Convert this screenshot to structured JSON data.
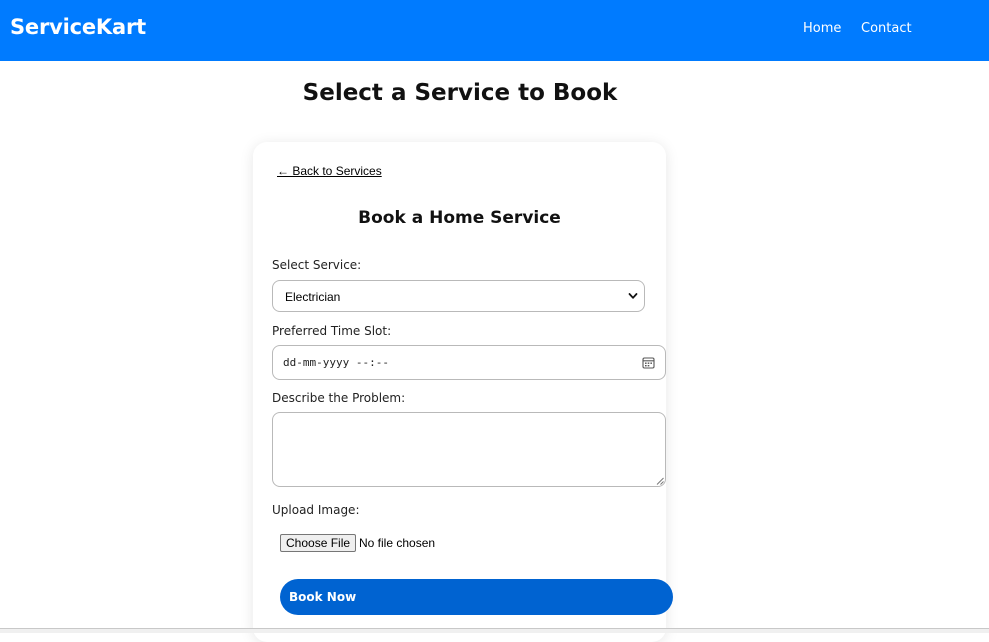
{
  "navbar": {
    "brand": "ServiceKart",
    "links": [
      {
        "label": "Home"
      },
      {
        "label": "Contact"
      }
    ],
    "bg_color": "#007bff"
  },
  "page": {
    "title": "Select a Service to Book"
  },
  "form": {
    "back_link": "← Back to Services",
    "title": "Book a Home Service",
    "service": {
      "label": "Select Service:",
      "selected": "Electrician"
    },
    "time_slot": {
      "label": "Preferred Time Slot:",
      "placeholder": "dd-mm-yyyy --:--"
    },
    "problem": {
      "label": "Describe the Problem:",
      "value": ""
    },
    "upload": {
      "label": "Upload Image:",
      "button": "Choose File",
      "status": "No file chosen"
    },
    "submit": {
      "label": "Book Now",
      "color": "#0063d1"
    }
  },
  "icons": {
    "select_chevron": "chevron-down-icon",
    "date_picker": "calendar-icon",
    "textarea_resize": "resize-handle-icon"
  }
}
